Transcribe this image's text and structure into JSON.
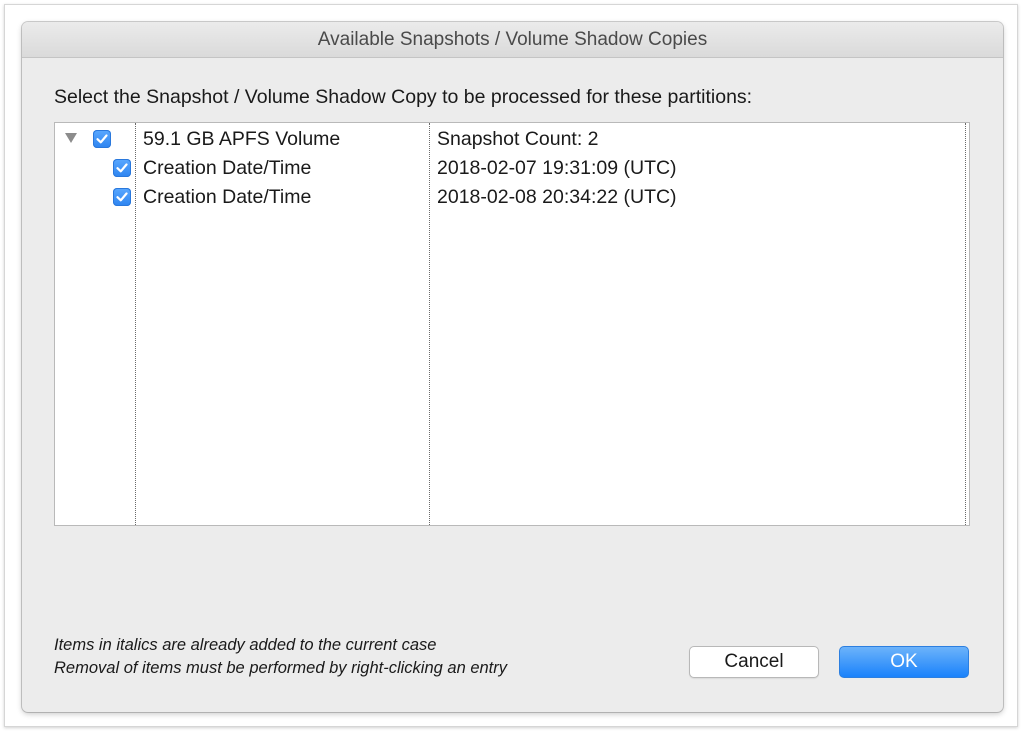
{
  "window": {
    "title": "Available Snapshots / Volume Shadow Copies"
  },
  "instruction": "Select the Snapshot / Volume Shadow Copy to be processed for these partitions:",
  "tree": {
    "rows": [
      {
        "level": 0,
        "expanded": true,
        "checked": true,
        "name": "59.1 GB APFS Volume",
        "value": "Snapshot Count: 2"
      },
      {
        "level": 1,
        "checked": true,
        "name": "Creation Date/Time",
        "value": "2018-02-07 19:31:09 (UTC)"
      },
      {
        "level": 1,
        "checked": true,
        "name": "Creation Date/Time",
        "value": "2018-02-08 20:34:22 (UTC)"
      }
    ]
  },
  "notes": {
    "line1": "Items in italics are already added to the current case",
    "line2": "Removal of items must be performed by right-clicking an entry"
  },
  "buttons": {
    "cancel": "Cancel",
    "ok": "OK"
  },
  "icons": {
    "disclosure": "disclosure-triangle-down-icon",
    "checkbox": "checkmark-icon"
  },
  "colors": {
    "accent": "#2d84f0",
    "window_bg": "#ececec",
    "separator": "#6a6a6a"
  }
}
